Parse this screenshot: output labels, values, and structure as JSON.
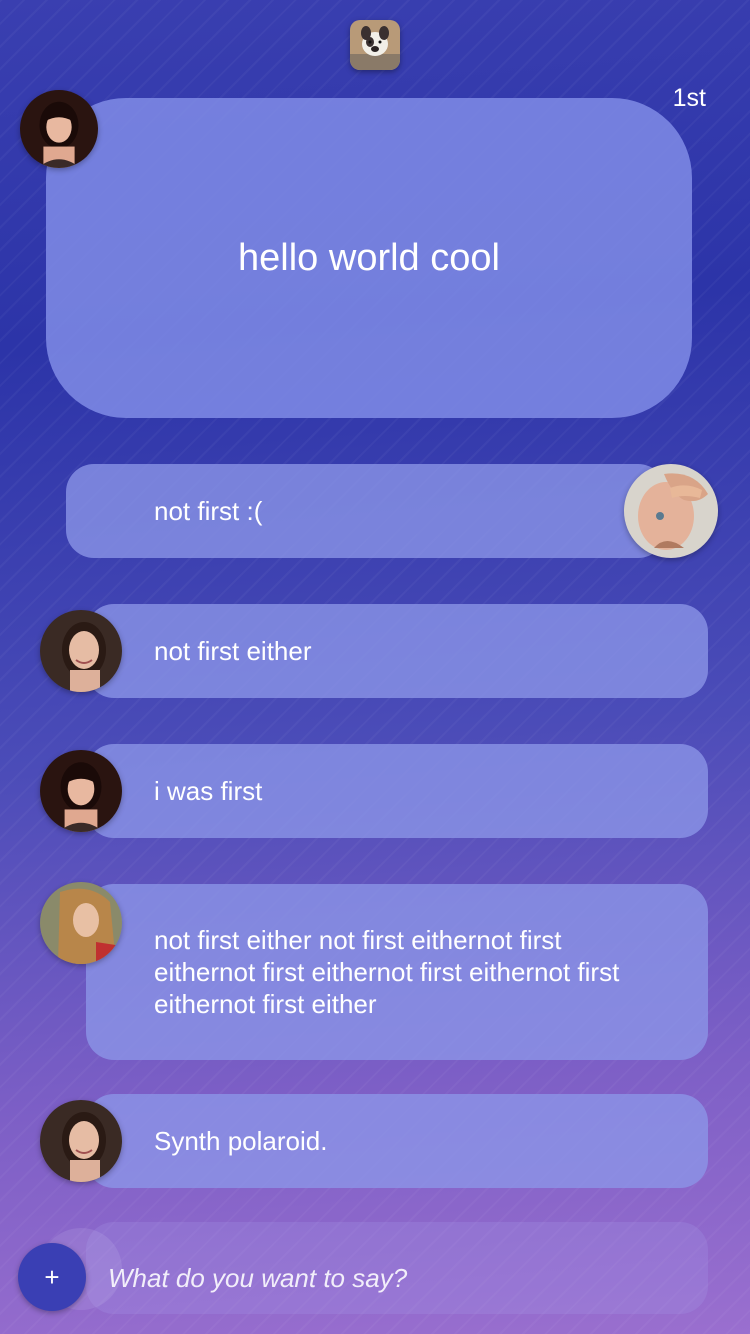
{
  "header": {
    "app_icon": "dog-app-icon",
    "rank_label": "1st"
  },
  "featured_message": {
    "text": "hello world cool",
    "avatar": "woman-dark-hair-avatar"
  },
  "messages": [
    {
      "text": "not first :(",
      "avatar": "man-hand-on-face-avatar",
      "side": "right"
    },
    {
      "text": "not first either",
      "avatar": "smiling-woman-avatar",
      "side": "left"
    },
    {
      "text": "i was first",
      "avatar": "woman-dark-hair-avatar",
      "side": "left"
    },
    {
      "text": "not first either not first eithernot first eithernot first eithernot first eithernot first eithernot first either",
      "avatar": "woman-blonde-hair-avatar",
      "side": "left"
    },
    {
      "text": "Synth polaroid.",
      "avatar": "smiling-woman-avatar",
      "side": "left"
    }
  ],
  "composer": {
    "add_label": "+",
    "placeholder": "What do you want to say?"
  },
  "colors": {
    "bubble": "#8c96e8",
    "add_button": "#3a3fb4",
    "background_top": "#3a3fb0",
    "background_bottom": "#9a6fcf"
  }
}
